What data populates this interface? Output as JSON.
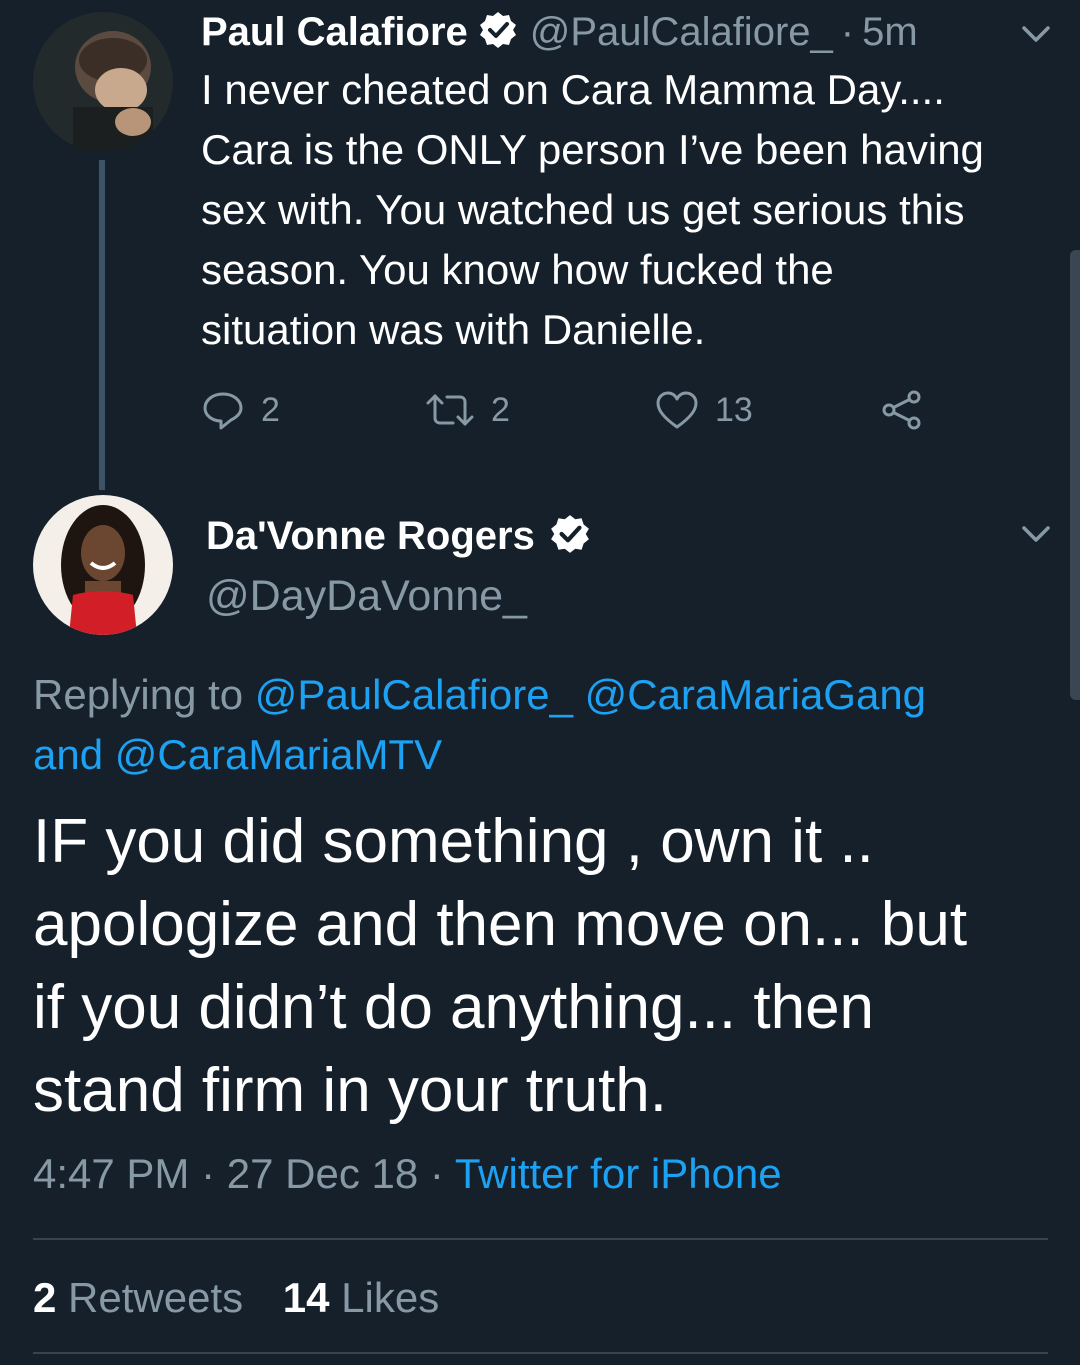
{
  "parent_tweet": {
    "author_name": "Paul Calafiore",
    "handle": "@PaulCalafiore_",
    "separator": "·",
    "time_ago": "5m",
    "text_lines": [
      "I never cheated on Cara Mamma Day....",
      "Cara is the ONLY person I’ve been having",
      "sex with. You watched us get serious this",
      "season. You know how fucked the",
      "situation was with Danielle."
    ],
    "replies": "2",
    "retweets": "2",
    "likes": "13",
    "icons": [
      "verified-badge-icon",
      "chevron-down-icon",
      "reply-icon",
      "retweet-icon",
      "like-icon",
      "share-icon"
    ]
  },
  "main_tweet": {
    "author_name": "Da'Vonne Rogers",
    "handle": "@DayDaVonne_",
    "replying_to_label": "Replying to",
    "mention_1": "@PaulCalafiore_",
    "mention_2": "@CaraMariaGang",
    "and_label": "and",
    "mention_3": "@CaraMariaMTV",
    "text_lines": [
      "IF you did something , own it ..",
      "apologize and then move on... but",
      "if you didn’t do anything... then",
      "stand firm in your truth."
    ],
    "time": "4:47 PM",
    "sep1": "·",
    "date": "27 Dec 18",
    "sep2": "·",
    "source": "Twitter for iPhone",
    "retweet_count": "2",
    "retweet_label": "Retweets",
    "like_count": "14",
    "like_label": "Likes"
  },
  "colors": {
    "background": "#15202b",
    "secondary_text": "#8899a6",
    "link": "#1da1f2",
    "divider": "#38444d"
  }
}
